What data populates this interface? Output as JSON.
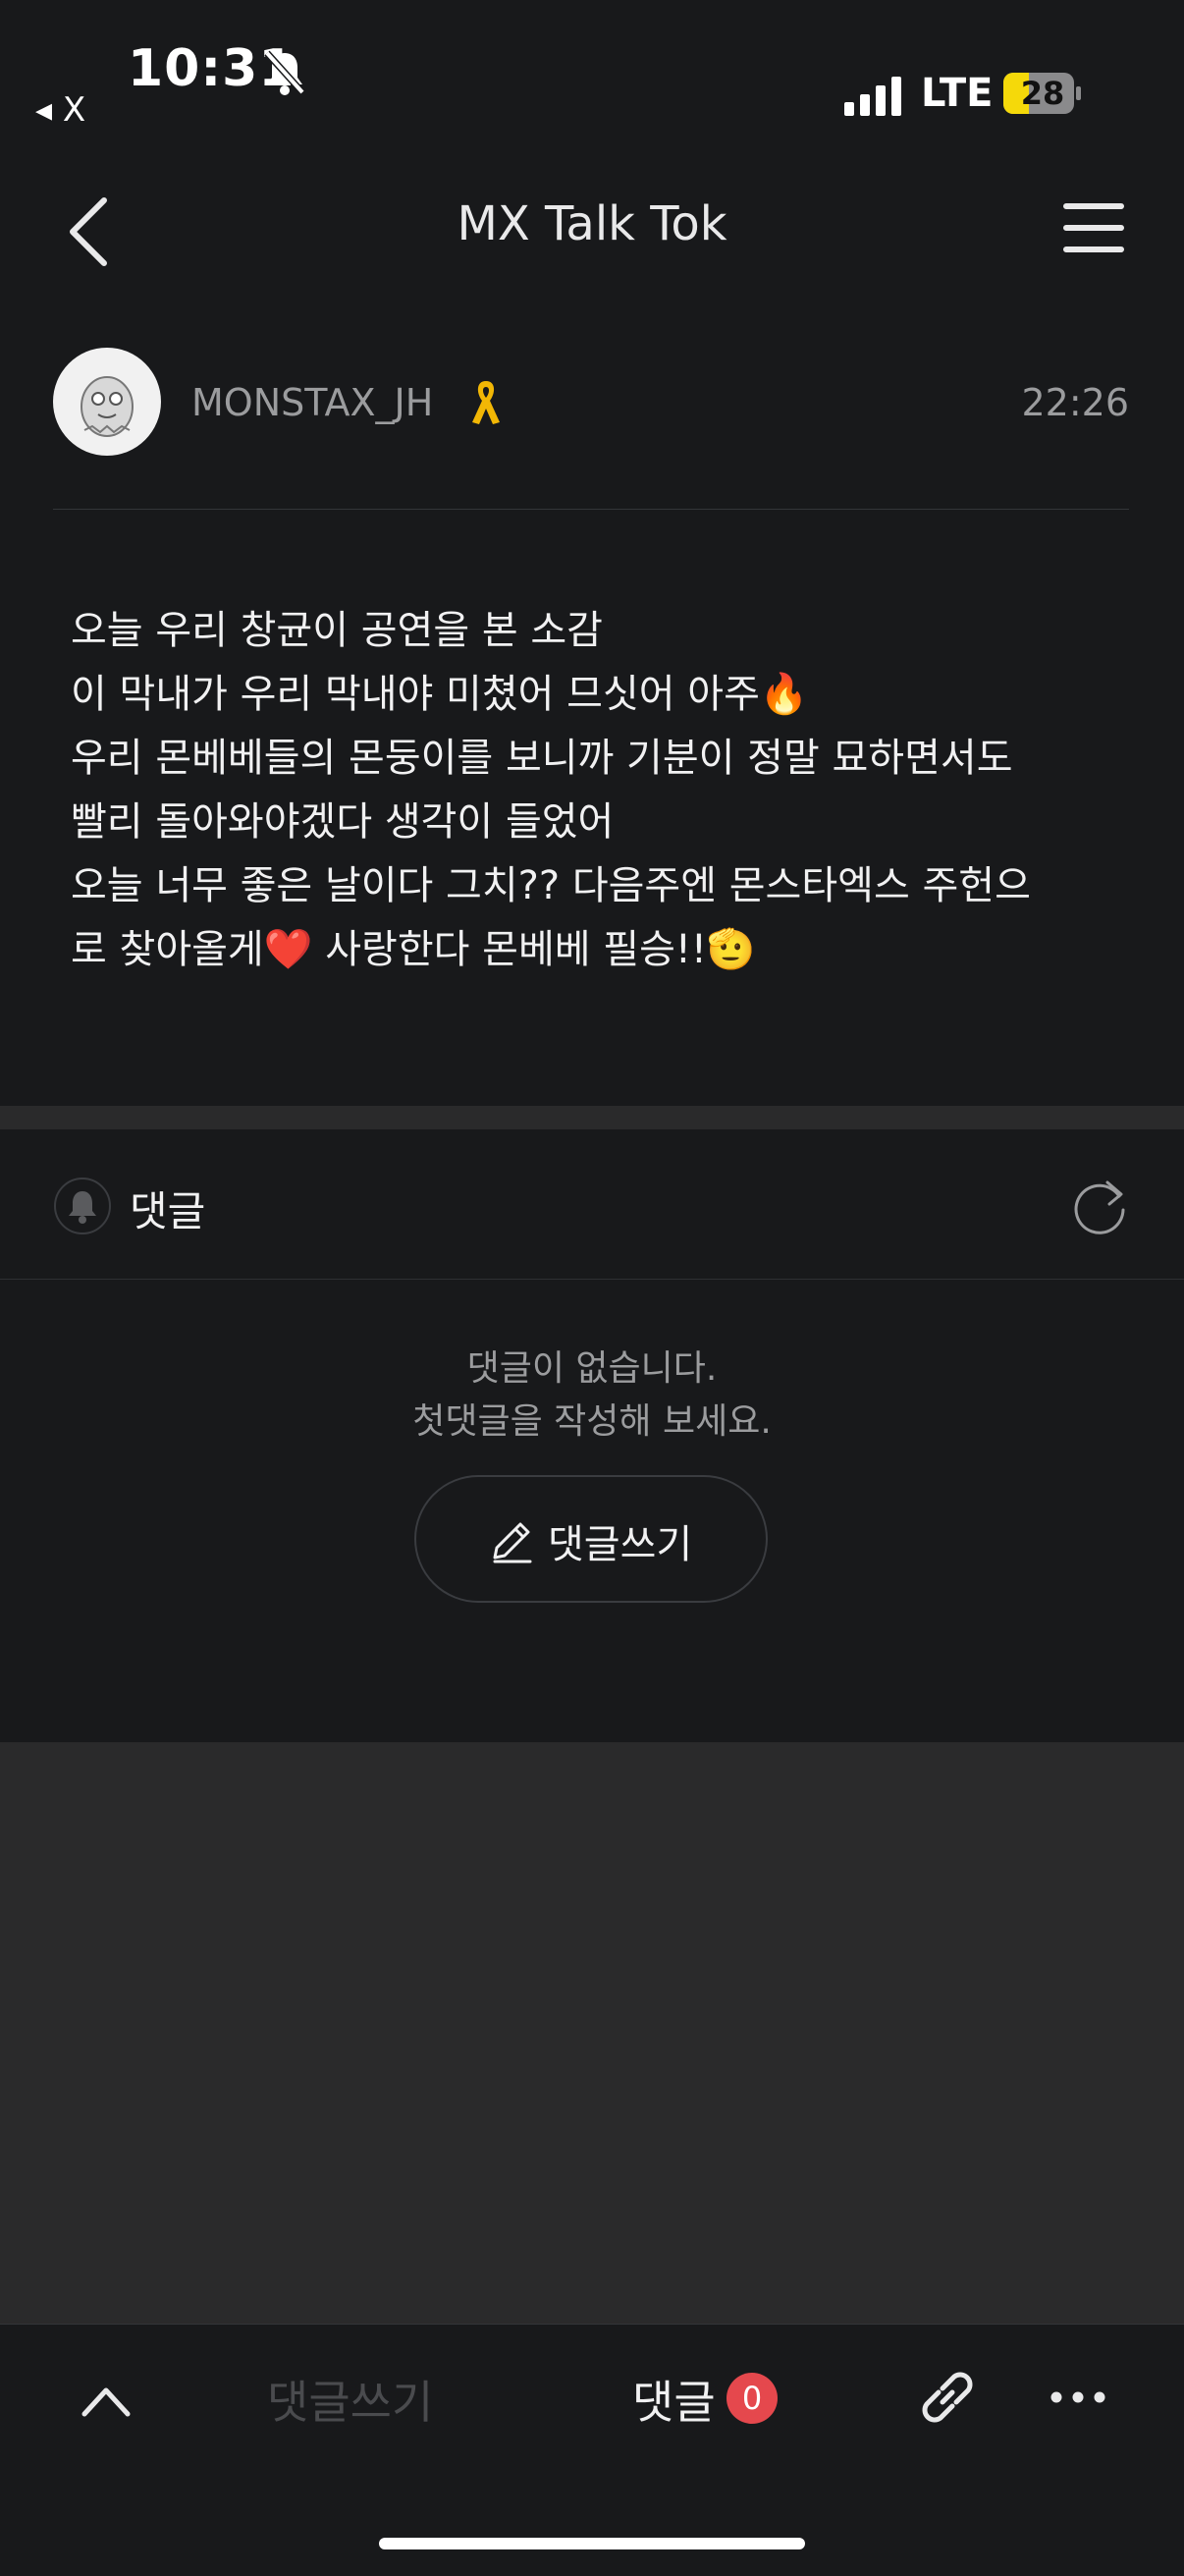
{
  "status_bar": {
    "time": "10:31",
    "back_app": "◂ X",
    "network": "LTE",
    "battery": "28",
    "icons": [
      "bell-slash-icon",
      "signal-icon",
      "battery-icon"
    ]
  },
  "header": {
    "title": "MX Talk Tok",
    "icons": [
      "back-arrow-icon",
      "hamburger-menu-icon"
    ]
  },
  "post": {
    "author": "MONSTAX_JH",
    "time": "22:26",
    "lines": [
      "오늘 우리 창균이 공연을 본 소감",
      "이 막내가 우리 막내야 미쳤어 므싯어 아주🔥",
      "우리 몬베베들의 몬둥이를 보니까 기분이 정말 묘하면서도",
      "빨리 돌아와야겠다 생각이 들었어",
      "오늘 너무 좋은 날이다 그치?? 다음주엔 몬스타엑스 주헌으",
      "로 찾아올게❤️ 사랑한다 몬베베 필승!!🫡"
    ]
  },
  "comments": {
    "title": "댓글",
    "empty_line1": "댓글이 없습니다.",
    "empty_line2": "첫댓글을 작성해 보세요.",
    "write_button": "댓글쓰기"
  },
  "bottom_bar": {
    "write_placeholder": "댓글쓰기",
    "comments_label": "댓글",
    "comments_count": "0"
  },
  "colors": {
    "background": "#18191b",
    "gap": "#2a2a2b",
    "badge": "#e5484d",
    "muted_text": "#9b9c9e"
  }
}
